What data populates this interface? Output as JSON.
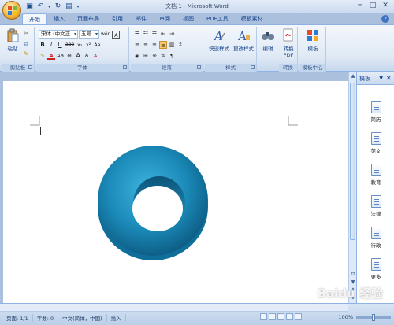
{
  "window": {
    "title": "文档 1 - Microsoft Word"
  },
  "tabs": [
    {
      "label": "开始",
      "active": true
    },
    {
      "label": "插入"
    },
    {
      "label": "页面布局"
    },
    {
      "label": "引用"
    },
    {
      "label": "邮件"
    },
    {
      "label": "审阅"
    },
    {
      "label": "视图"
    },
    {
      "label": "PDF工具"
    },
    {
      "label": "模板素材"
    }
  ],
  "ribbon": {
    "clipboard": {
      "title": "剪贴板",
      "paste_label": "粘贴"
    },
    "font": {
      "title": "字体",
      "font_name": "宋体 (中文正",
      "font_size": "五号",
      "bold": "B",
      "italic": "I",
      "underline": "U",
      "strike": "abe",
      "sub": "x₂",
      "sup": "x²",
      "change_case": "Aa",
      "font_color": "A",
      "grow": "A",
      "shrink": "A",
      "clear": "A",
      "phonetic": "wén",
      "border_char": "A"
    },
    "paragraph": {
      "title": "段落"
    },
    "styles": {
      "title": "样式",
      "quick_styles": "快速样式",
      "change_styles": "更改样式"
    },
    "editing": {
      "title": "",
      "edit_label": "编辑"
    },
    "convert": {
      "title": "转换",
      "pdf_label": "转换\nPDF",
      "pdf_line1": "转换",
      "pdf_line2": "PDF"
    },
    "template_center": {
      "title": "模板中心",
      "template_label": "模板"
    }
  },
  "pane": {
    "title": "模板",
    "items": [
      {
        "label": "简历"
      },
      {
        "label": "范文"
      },
      {
        "label": "教育"
      },
      {
        "label": "法律"
      },
      {
        "label": "行政"
      },
      {
        "label": "更多"
      }
    ]
  },
  "status": {
    "page": "页面: 1/1",
    "words": "字数: 0",
    "language": "中文(简体，中国)",
    "mode": "插入",
    "zoom": "100%",
    "zoom_level": 0.5
  },
  "watermark": "Baidu 经验",
  "colors": {
    "accent": "#15428b",
    "torus": "#1b8ab8",
    "ribbon_bg": "#dfe9f5"
  }
}
